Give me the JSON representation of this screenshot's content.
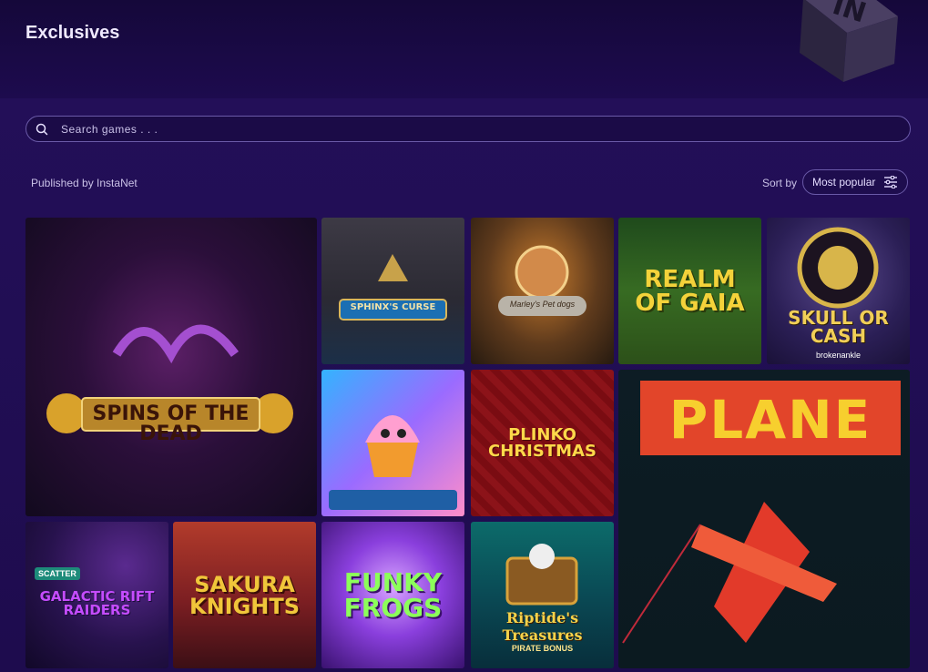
{
  "header": {
    "title": "Exclusives",
    "logo_text": "IN"
  },
  "search": {
    "placeholder": "Search games . . ."
  },
  "filters": {
    "publisher_label": "Published by InstaNet",
    "sort_label": "Sort by",
    "sort_selected": "Most popular"
  },
  "games": [
    {
      "title": "SPINS of the DEAD",
      "sub": ""
    },
    {
      "title": "SPHINX'S CURSE",
      "sub": ""
    },
    {
      "title": "Marley's Pet dogs",
      "sub": ""
    },
    {
      "title": "REALM OF GAIA",
      "sub": ""
    },
    {
      "title": "SKULL OR CASH",
      "sub": "brokenankle"
    },
    {
      "title": "",
      "sub": ""
    },
    {
      "title": "PLINKO CHRISTMAS",
      "sub": ""
    },
    {
      "title": "PLANE",
      "sub": ""
    },
    {
      "title": "GALACTIC RIFT RAIDERS",
      "sub": "SCATTER"
    },
    {
      "title": "SAKURA KNIGHTS",
      "sub": ""
    },
    {
      "title": "FUNKY FROGS",
      "sub": ""
    },
    {
      "title": "Riptide's Treasures",
      "sub": "PIRATE BONUS"
    }
  ],
  "colors": {
    "background": "#1c0a4a",
    "border": "#6a5aa8",
    "text_muted": "#c9c1e6"
  }
}
